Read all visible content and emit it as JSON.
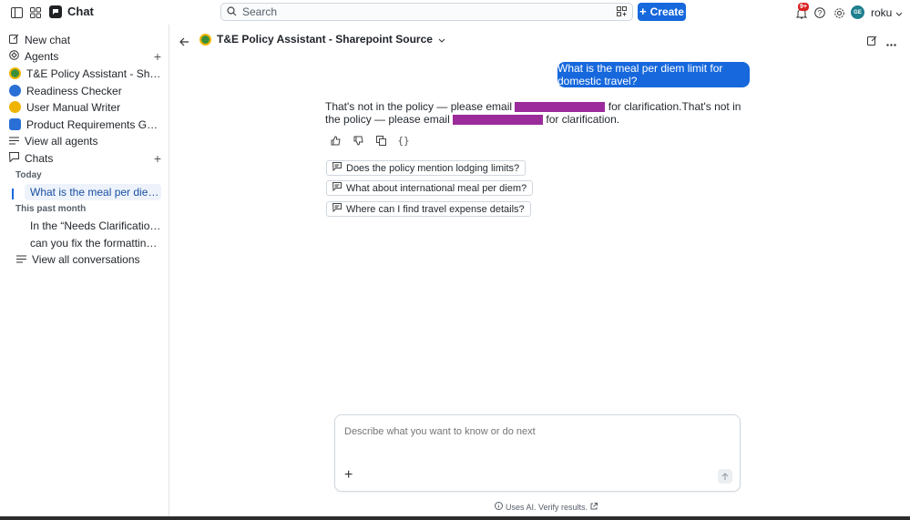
{
  "topbar": {
    "app_title": "Chat",
    "search_placeholder": "Search",
    "create_label": "Create",
    "notification_badge": "9+",
    "avatar_initials": "GE",
    "username": "roku"
  },
  "sidebar": {
    "new_chat": "New chat",
    "agents_label": "Agents",
    "agents": [
      {
        "label": "T&E Policy Assistant - Sharepoint Source",
        "icon": "agent-green-icon",
        "color": "#3b8f3b"
      },
      {
        "label": "Readiness Checker",
        "icon": "agent-blue-icon",
        "color": "#2a6fd6"
      },
      {
        "label": "User Manual Writer",
        "icon": "agent-yellow-icon",
        "color": "#f0b400"
      },
      {
        "label": "Product Requirements Guide",
        "icon": "agent-hexagon-icon",
        "color": "#2a6fd6"
      }
    ],
    "view_all_agents": "View all agents",
    "chats_label": "Chats",
    "today_label": "Today",
    "today_chats": [
      "What is the meal per diem limit for domestic travel?"
    ],
    "past_month_label": "This past month",
    "past_month_chats": [
      "In the “Needs Clarification” section of the doc",
      "can you fix the formatting on this document"
    ],
    "view_all_conversations": "View all conversations"
  },
  "main": {
    "agent_title": "T&E Policy Assistant - Sharepoint Source",
    "user_message": "What is the meal per diem limit for domestic travel?",
    "answer": {
      "part1": "That's not in the policy — please email",
      "part2": "for clarification.That's not in the policy — please email",
      "part3": "for clarification."
    },
    "suggestions": [
      "Does the policy mention lodging limits?",
      "What about international meal per diem?",
      "Where can I find travel expense details?"
    ],
    "composer_placeholder": "Describe what you want to know or do next",
    "disclaimer": "Uses AI. Verify results."
  },
  "colors": {
    "accent": "#1668dc",
    "redaction": "#9b2b9b"
  }
}
